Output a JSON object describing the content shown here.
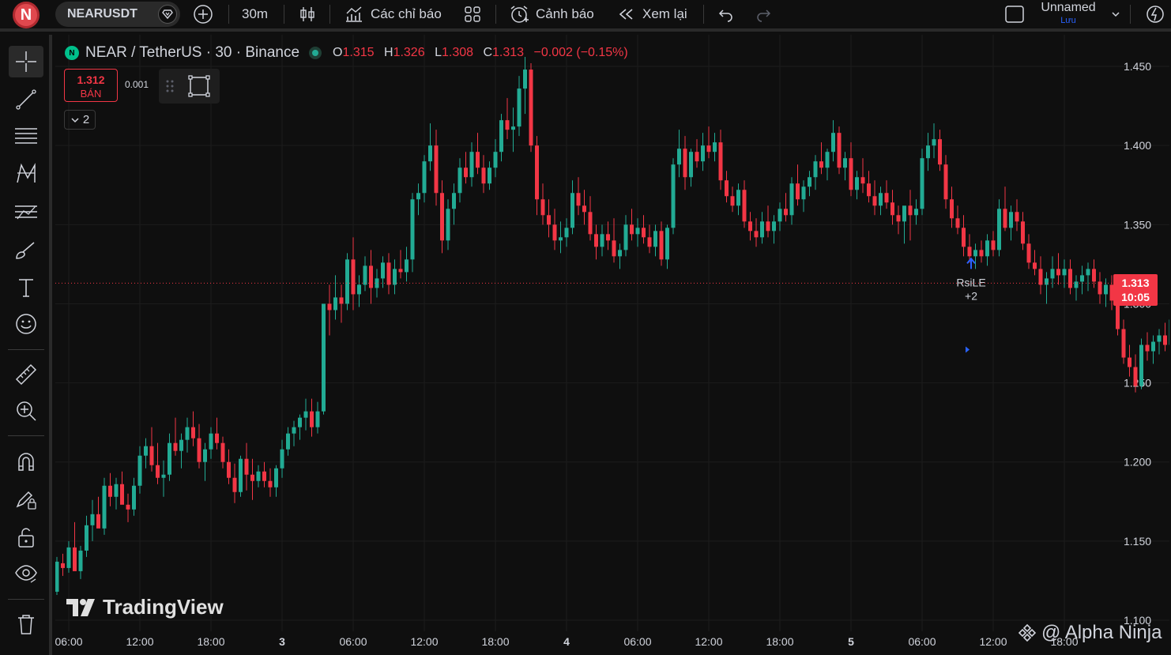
{
  "topbar": {
    "avatar_letter": "N",
    "symbol": "NEARUSDT",
    "interval": "30m",
    "indicators_label": "Các chỉ báo",
    "alerts_label": "Cảnh báo",
    "replay_label": "Xem lại",
    "layout_name": "Unnamed",
    "save_label": "Lưu"
  },
  "legend": {
    "title": "NEAR / TetherUS · 30 · Binance",
    "coin_letter": "N",
    "o_key": "O",
    "o_val": "1.315",
    "h_key": "H",
    "h_val": "1.326",
    "l_key": "L",
    "l_val": "1.308",
    "c_key": "C",
    "c_val": "1.313",
    "change": "−0.002 (−0.15%)"
  },
  "trade": {
    "sell_price": "1.312",
    "sell_label": "BÁN",
    "spread": "0.001",
    "collapse_count": "2"
  },
  "price_label": {
    "price": "1.313",
    "countdown": "10:05"
  },
  "signal": {
    "label": "RsiLE",
    "count": "+2"
  },
  "watermark": "TradingView",
  "credit": "@ Alpha Ninja",
  "colors": {
    "up": "#22ab94",
    "down": "#f23645",
    "bg": "#0f0f0f",
    "grid": "#1c1c1c",
    "signal": "#2962ff"
  },
  "chart_data": {
    "type": "candlestick",
    "y_ticks": [
      "1.450",
      "1.400",
      "1.350",
      "1.300",
      "1.250",
      "1.200",
      "1.150",
      "1.100"
    ],
    "ylim": [
      1.093,
      1.47
    ],
    "current_price": 1.313,
    "x_ticks": [
      {
        "label": "06:00",
        "bold": false,
        "i": 2
      },
      {
        "label": "12:00",
        "bold": false,
        "i": 14
      },
      {
        "label": "18:00",
        "bold": false,
        "i": 26
      },
      {
        "label": "3",
        "bold": true,
        "i": 38
      },
      {
        "label": "06:00",
        "bold": false,
        "i": 50
      },
      {
        "label": "12:00",
        "bold": false,
        "i": 62
      },
      {
        "label": "18:00",
        "bold": false,
        "i": 74
      },
      {
        "label": "4",
        "bold": true,
        "i": 86
      },
      {
        "label": "06:00",
        "bold": false,
        "i": 98
      },
      {
        "label": "12:00",
        "bold": false,
        "i": 110
      },
      {
        "label": "18:00",
        "bold": false,
        "i": 122
      },
      {
        "label": "5",
        "bold": true,
        "i": 134
      },
      {
        "label": "06:00",
        "bold": false,
        "i": 146
      },
      {
        "label": "12:00",
        "bold": false,
        "i": 158
      },
      {
        "label": "18:00",
        "bold": false,
        "i": 170
      }
    ],
    "signal_index": 154,
    "candles": [
      [
        1.118,
        1.14,
        1.116,
        1.137
      ],
      [
        1.136,
        1.142,
        1.128,
        1.133
      ],
      [
        1.133,
        1.15,
        1.13,
        1.146
      ],
      [
        1.146,
        1.162,
        1.138,
        1.131
      ],
      [
        1.131,
        1.147,
        1.126,
        1.144
      ],
      [
        1.144,
        1.166,
        1.14,
        1.16
      ],
      [
        1.16,
        1.176,
        1.15,
        1.167
      ],
      [
        1.167,
        1.178,
        1.16,
        1.158
      ],
      [
        1.158,
        1.19,
        1.154,
        1.185
      ],
      [
        1.185,
        1.193,
        1.172,
        1.178
      ],
      [
        1.178,
        1.19,
        1.17,
        1.186
      ],
      [
        1.186,
        1.194,
        1.176,
        1.173
      ],
      [
        1.173,
        1.18,
        1.162,
        1.17
      ],
      [
        1.17,
        1.19,
        1.166,
        1.185
      ],
      [
        1.185,
        1.21,
        1.18,
        1.204
      ],
      [
        1.204,
        1.215,
        1.196,
        1.21
      ],
      [
        1.21,
        1.222,
        1.194,
        1.198
      ],
      [
        1.198,
        1.212,
        1.186,
        1.19
      ],
      [
        1.19,
        1.201,
        1.178,
        1.192
      ],
      [
        1.192,
        1.218,
        1.188,
        1.212
      ],
      [
        1.212,
        1.228,
        1.204,
        1.207
      ],
      [
        1.207,
        1.218,
        1.196,
        1.214
      ],
      [
        1.214,
        1.228,
        1.206,
        1.222
      ],
      [
        1.222,
        1.232,
        1.21,
        1.215
      ],
      [
        1.215,
        1.224,
        1.196,
        1.2
      ],
      [
        1.2,
        1.212,
        1.188,
        1.208
      ],
      [
        1.208,
        1.222,
        1.202,
        1.218
      ],
      [
        1.218,
        1.228,
        1.208,
        1.212
      ],
      [
        1.212,
        1.216,
        1.196,
        1.2
      ],
      [
        1.2,
        1.208,
        1.186,
        1.19
      ],
      [
        1.19,
        1.199,
        1.174,
        1.181
      ],
      [
        1.181,
        1.204,
        1.178,
        1.202
      ],
      [
        1.202,
        1.212,
        1.182,
        1.192
      ],
      [
        1.192,
        1.202,
        1.176,
        1.188
      ],
      [
        1.188,
        1.198,
        1.184,
        1.194
      ],
      [
        1.194,
        1.2,
        1.184,
        1.188
      ],
      [
        1.188,
        1.196,
        1.178,
        1.184
      ],
      [
        1.184,
        1.198,
        1.178,
        1.196
      ],
      [
        1.196,
        1.214,
        1.19,
        1.208
      ],
      [
        1.208,
        1.222,
        1.204,
        1.218
      ],
      [
        1.218,
        1.226,
        1.21,
        1.222
      ],
      [
        1.222,
        1.23,
        1.214,
        1.228
      ],
      [
        1.228,
        1.24,
        1.22,
        1.232
      ],
      [
        1.232,
        1.24,
        1.216,
        1.222
      ],
      [
        1.222,
        1.238,
        1.218,
        1.232
      ],
      [
        1.232,
        1.282,
        1.23,
        1.3
      ],
      [
        1.3,
        1.312,
        1.28,
        1.296
      ],
      [
        1.296,
        1.318,
        1.29,
        1.304
      ],
      [
        1.304,
        1.312,
        1.288,
        1.3
      ],
      [
        1.3,
        1.332,
        1.296,
        1.328
      ],
      [
        1.328,
        1.342,
        1.296,
        1.306
      ],
      [
        1.306,
        1.318,
        1.298,
        1.312
      ],
      [
        1.312,
        1.33,
        1.308,
        1.324
      ],
      [
        1.324,
        1.334,
        1.3,
        1.31
      ],
      [
        1.31,
        1.322,
        1.304,
        1.316
      ],
      [
        1.316,
        1.33,
        1.31,
        1.326
      ],
      [
        1.326,
        1.332,
        1.306,
        1.312
      ],
      [
        1.312,
        1.328,
        1.306,
        1.322
      ],
      [
        1.322,
        1.334,
        1.316,
        1.32
      ],
      [
        1.32,
        1.336,
        1.314,
        1.328
      ],
      [
        1.328,
        1.37,
        1.32,
        1.366
      ],
      [
        1.366,
        1.376,
        1.356,
        1.37
      ],
      [
        1.37,
        1.394,
        1.364,
        1.39
      ],
      [
        1.39,
        1.414,
        1.384,
        1.4
      ],
      [
        1.4,
        1.41,
        1.362,
        1.37
      ],
      [
        1.37,
        1.378,
        1.332,
        1.34
      ],
      [
        1.34,
        1.366,
        1.334,
        1.36
      ],
      [
        1.36,
        1.376,
        1.35,
        1.37
      ],
      [
        1.37,
        1.392,
        1.364,
        1.386
      ],
      [
        1.386,
        1.396,
        1.376,
        1.38
      ],
      [
        1.38,
        1.402,
        1.374,
        1.396
      ],
      [
        1.396,
        1.408,
        1.382,
        1.386
      ],
      [
        1.386,
        1.394,
        1.37,
        1.376
      ],
      [
        1.376,
        1.39,
        1.372,
        1.386
      ],
      [
        1.386,
        1.404,
        1.38,
        1.396
      ],
      [
        1.396,
        1.42,
        1.39,
        1.416
      ],
      [
        1.416,
        1.43,
        1.404,
        1.41
      ],
      [
        1.41,
        1.424,
        1.396,
        1.412
      ],
      [
        1.412,
        1.444,
        1.406,
        1.436
      ],
      [
        1.436,
        1.456,
        1.42,
        1.448
      ],
      [
        1.448,
        1.452,
        1.396,
        1.4
      ],
      [
        1.4,
        1.406,
        1.356,
        1.366
      ],
      [
        1.366,
        1.376,
        1.35,
        1.356
      ],
      [
        1.356,
        1.366,
        1.342,
        1.35
      ],
      [
        1.35,
        1.36,
        1.334,
        1.34
      ],
      [
        1.34,
        1.352,
        1.332,
        1.342
      ],
      [
        1.342,
        1.354,
        1.336,
        1.348
      ],
      [
        1.348,
        1.378,
        1.344,
        1.37
      ],
      [
        1.37,
        1.38,
        1.356,
        1.362
      ],
      [
        1.362,
        1.372,
        1.35,
        1.358
      ],
      [
        1.358,
        1.368,
        1.34,
        1.344
      ],
      [
        1.344,
        1.35,
        1.328,
        1.336
      ],
      [
        1.336,
        1.35,
        1.33,
        1.344
      ],
      [
        1.344,
        1.352,
        1.334,
        1.34
      ],
      [
        1.34,
        1.354,
        1.326,
        1.33
      ],
      [
        1.33,
        1.338,
        1.322,
        1.334
      ],
      [
        1.334,
        1.356,
        1.33,
        1.35
      ],
      [
        1.35,
        1.36,
        1.34,
        1.344
      ],
      [
        1.344,
        1.354,
        1.336,
        1.348
      ],
      [
        1.348,
        1.356,
        1.338,
        1.342
      ],
      [
        1.342,
        1.35,
        1.332,
        1.336
      ],
      [
        1.336,
        1.35,
        1.33,
        1.346
      ],
      [
        1.346,
        1.352,
        1.324,
        1.328
      ],
      [
        1.328,
        1.35,
        1.322,
        1.348
      ],
      [
        1.348,
        1.392,
        1.344,
        1.388
      ],
      [
        1.388,
        1.41,
        1.38,
        1.398
      ],
      [
        1.398,
        1.406,
        1.372,
        1.38
      ],
      [
        1.38,
        1.398,
        1.374,
        1.396
      ],
      [
        1.396,
        1.404,
        1.386,
        1.39
      ],
      [
        1.39,
        1.408,
        1.384,
        1.4
      ],
      [
        1.4,
        1.412,
        1.392,
        1.396
      ],
      [
        1.396,
        1.408,
        1.39,
        1.402
      ],
      [
        1.402,
        1.41,
        1.372,
        1.378
      ],
      [
        1.378,
        1.384,
        1.364,
        1.368
      ],
      [
        1.368,
        1.374,
        1.358,
        1.362
      ],
      [
        1.362,
        1.376,
        1.356,
        1.372
      ],
      [
        1.372,
        1.378,
        1.348,
        1.352
      ],
      [
        1.352,
        1.358,
        1.34,
        1.346
      ],
      [
        1.346,
        1.354,
        1.336,
        1.342
      ],
      [
        1.342,
        1.358,
        1.338,
        1.352
      ],
      [
        1.352,
        1.362,
        1.342,
        1.346
      ],
      [
        1.346,
        1.356,
        1.338,
        1.352
      ],
      [
        1.352,
        1.364,
        1.346,
        1.36
      ],
      [
        1.36,
        1.37,
        1.352,
        1.356
      ],
      [
        1.356,
        1.38,
        1.35,
        1.376
      ],
      [
        1.376,
        1.388,
        1.362,
        1.366
      ],
      [
        1.366,
        1.378,
        1.358,
        1.374
      ],
      [
        1.374,
        1.384,
        1.368,
        1.38
      ],
      [
        1.38,
        1.394,
        1.372,
        1.39
      ],
      [
        1.39,
        1.402,
        1.382,
        1.386
      ],
      [
        1.386,
        1.398,
        1.378,
        1.396
      ],
      [
        1.396,
        1.416,
        1.39,
        1.408
      ],
      [
        1.408,
        1.412,
        1.382,
        1.386
      ],
      [
        1.386,
        1.396,
        1.378,
        1.392
      ],
      [
        1.392,
        1.402,
        1.368,
        1.372
      ],
      [
        1.372,
        1.384,
        1.366,
        1.38
      ],
      [
        1.38,
        1.392,
        1.37,
        1.376
      ],
      [
        1.376,
        1.384,
        1.364,
        1.368
      ],
      [
        1.368,
        1.378,
        1.356,
        1.362
      ],
      [
        1.362,
        1.374,
        1.356,
        1.37
      ],
      [
        1.37,
        1.378,
        1.36,
        1.364
      ],
      [
        1.364,
        1.372,
        1.35,
        1.356
      ],
      [
        1.356,
        1.362,
        1.344,
        1.352
      ],
      [
        1.352,
        1.36,
        1.338,
        1.362
      ],
      [
        1.362,
        1.372,
        1.34,
        1.356
      ],
      [
        1.356,
        1.366,
        1.35,
        1.36
      ],
      [
        1.36,
        1.398,
        1.356,
        1.392
      ],
      [
        1.392,
        1.408,
        1.384,
        1.4
      ],
      [
        1.4,
        1.414,
        1.392,
        1.404
      ],
      [
        1.404,
        1.41,
        1.384,
        1.388
      ],
      [
        1.388,
        1.394,
        1.36,
        1.366
      ],
      [
        1.366,
        1.374,
        1.348,
        1.354
      ],
      [
        1.354,
        1.362,
        1.344,
        1.348
      ],
      [
        1.348,
        1.356,
        1.33,
        1.336
      ],
      [
        1.336,
        1.344,
        1.326,
        1.33
      ],
      [
        1.33,
        1.338,
        1.322,
        1.334
      ],
      [
        1.334,
        1.34,
        1.326,
        1.33
      ],
      [
        1.33,
        1.344,
        1.324,
        1.34
      ],
      [
        1.34,
        1.346,
        1.33,
        1.334
      ],
      [
        1.334,
        1.366,
        1.33,
        1.36
      ],
      [
        1.36,
        1.374,
        1.346,
        1.348
      ],
      [
        1.348,
        1.362,
        1.34,
        1.358
      ],
      [
        1.358,
        1.366,
        1.346,
        1.352
      ],
      [
        1.352,
        1.358,
        1.334,
        1.338
      ],
      [
        1.338,
        1.344,
        1.322,
        1.326
      ],
      [
        1.326,
        1.334,
        1.318,
        1.322
      ],
      [
        1.322,
        1.33,
        1.306,
        1.312
      ],
      [
        1.312,
        1.32,
        1.3,
        1.316
      ],
      [
        1.316,
        1.33,
        1.31,
        1.322
      ],
      [
        1.322,
        1.332,
        1.312,
        1.318
      ],
      [
        1.318,
        1.328,
        1.31,
        1.322
      ],
      [
        1.322,
        1.328,
        1.306,
        1.31
      ],
      [
        1.31,
        1.318,
        1.302,
        1.314
      ],
      [
        1.314,
        1.324,
        1.306,
        1.318
      ],
      [
        1.318,
        1.326,
        1.308,
        1.322
      ],
      [
        1.322,
        1.328,
        1.31,
        1.314
      ],
      [
        1.314,
        1.32,
        1.3,
        1.306
      ],
      [
        1.306,
        1.316,
        1.298,
        1.312
      ],
      [
        1.312,
        1.318,
        1.296,
        1.302
      ],
      [
        1.302,
        1.308,
        1.28,
        1.284
      ],
      [
        1.284,
        1.29,
        1.262,
        1.266
      ],
      [
        1.266,
        1.274,
        1.254,
        1.26
      ],
      [
        1.26,
        1.268,
        1.244,
        1.248
      ],
      [
        1.248,
        1.278,
        1.246,
        1.274
      ],
      [
        1.274,
        1.282,
        1.264,
        1.27
      ],
      [
        1.27,
        1.28,
        1.262,
        1.276
      ],
      [
        1.276,
        1.284,
        1.268,
        1.28
      ],
      [
        1.28,
        1.288,
        1.27,
        1.274
      ],
      [
        1.274,
        1.294,
        1.266,
        1.29
      ],
      [
        1.29,
        1.298,
        1.282,
        1.286
      ],
      [
        1.286,
        1.296,
        1.28,
        1.292
      ],
      [
        1.292,
        1.3,
        1.284,
        1.288
      ],
      [
        1.288,
        1.304,
        1.284,
        1.3
      ],
      [
        1.3,
        1.308,
        1.292,
        1.304
      ],
      [
        1.304,
        1.31,
        1.296,
        1.3
      ],
      [
        1.3,
        1.312,
        1.294,
        1.308
      ],
      [
        1.308,
        1.318,
        1.302,
        1.304
      ],
      [
        1.304,
        1.334,
        1.3,
        1.318
      ],
      [
        1.315,
        1.326,
        1.308,
        1.313
      ]
    ]
  }
}
